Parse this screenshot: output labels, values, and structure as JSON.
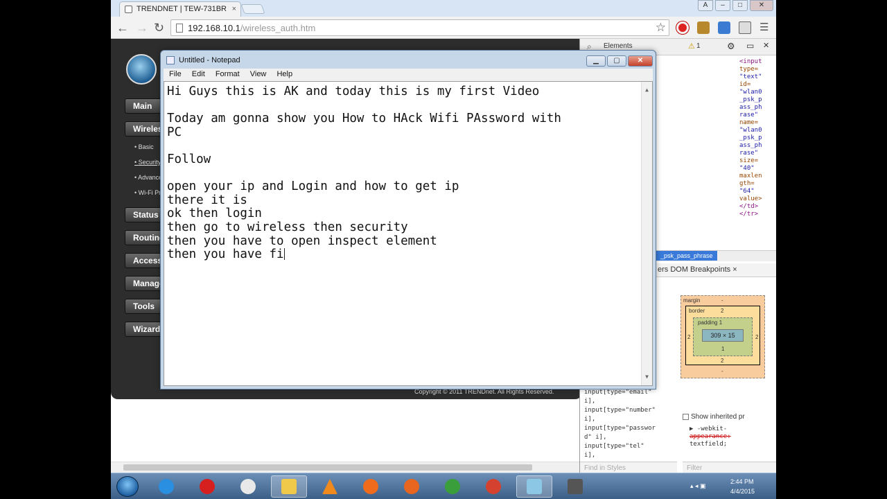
{
  "browser": {
    "tab_title": "TRENDNET | TEW-731BR",
    "tab_close": "×",
    "url_host": "192.168.10.1",
    "url_path": "/wireless_auth.htm",
    "window_buttons": {
      "account": "A",
      "minimize": "–",
      "maximize": "□",
      "close": "✕"
    },
    "back": "←",
    "forward": "→",
    "reload": "↻",
    "bookmark_star": "☆",
    "menu": "☰",
    "toolbar_icons": [
      "opera-icon",
      "extension-icon",
      "profile-icon",
      "translate-icon"
    ]
  },
  "router": {
    "menu": [
      "Main",
      "Wireless",
      "Status",
      "Routing",
      "Access",
      "Management",
      "Tools",
      "Wizard"
    ],
    "wireless_subitems": [
      "Basic",
      "Security",
      "Advanced",
      "Wi-Fi Protected"
    ],
    "copyright": "Copyright © 2011 TRENDnet. All Rights Reserved."
  },
  "devtools": {
    "toolbar_tab": "Elements",
    "warnings": "1",
    "code_lines": [
      {
        "t": "<input",
        "k": "tag"
      },
      {
        "t": "type=",
        "k": "attr"
      },
      {
        "t": "\"text\"",
        "k": "val"
      },
      {
        "t": "id=",
        "k": "attr"
      },
      {
        "t": "\"wlan0",
        "k": "val"
      },
      {
        "t": "_psk_p",
        "k": "val"
      },
      {
        "t": "ass_ph",
        "k": "val"
      },
      {
        "t": "rase\"",
        "k": "val"
      },
      {
        "t": "name=",
        "k": "attr"
      },
      {
        "t": "\"wlan0",
        "k": "val"
      },
      {
        "t": "_psk_p",
        "k": "val"
      },
      {
        "t": "ass_ph",
        "k": "val"
      },
      {
        "t": "rase\"",
        "k": "val"
      },
      {
        "t": "size=",
        "k": "attr"
      },
      {
        "t": "\"40\"",
        "k": "val"
      },
      {
        "t": "maxlen",
        "k": "attr"
      },
      {
        "t": "gth=",
        "k": "attr"
      },
      {
        "t": "\"64\"",
        "k": "val"
      },
      {
        "t": "value>",
        "k": "attr"
      },
      {
        "t": "</td>",
        "k": "tag"
      },
      {
        "t": "</tr>",
        "k": "tag"
      }
    ],
    "breadcrumb": "_psk_pass_phrase",
    "panel_tabs": "ers   DOM Breakpoints ×",
    "styles_lines": [
      "input[type=\"email\"",
      "i],",
      "input[type=\"number\"",
      "i],",
      "input[type=\"passwor",
      "d\" i],",
      "input[type=\"tel\"",
      "i],"
    ],
    "box_model": {
      "margin_label": "margin",
      "margin_value": "-",
      "border_label": "border",
      "border_value": "2",
      "padding_label": "padding 1",
      "content": "309 × 15",
      "side_value": "2",
      "padding_bottom": "1",
      "border_bottom": "2",
      "margin_bottom": "-"
    },
    "show_inherited": "Show inherited pr",
    "inherited_css": [
      "▶ -webkit-",
      "appearance:",
      "textfield;"
    ],
    "find_in_styles": "Find in Styles",
    "filter": "Filter"
  },
  "notepad": {
    "title": "Untitled - Notepad",
    "menu": [
      "File",
      "Edit",
      "Format",
      "View",
      "Help"
    ],
    "lines": [
      "Hi Guys this is AK and today this is my first Video",
      "",
      "Today am gonna show you How to HAck Wifi PAssword with",
      "PC",
      "",
      "Follow",
      "",
      "open your ip and Login and how to get ip",
      "there it is",
      "ok then login",
      "then go to wireless then security",
      "then you have to open inspect element",
      "then you have fi"
    ]
  },
  "taskbar": {
    "apps": [
      "ie-icon",
      "opera-icon",
      "paint-icon",
      "explorer-icon",
      "vlc-icon",
      "media-player-icon",
      "firefox-icon",
      "chrome-icon",
      "chrome-icon-2",
      "notepad-icon",
      "games-icon"
    ],
    "time": "2:44 PM",
    "date": "4/4/2015"
  },
  "colors": {
    "router_bg": "#2d2d2d",
    "devtools_highlight": "#3879d9",
    "taskbar": "#4a6f98"
  }
}
